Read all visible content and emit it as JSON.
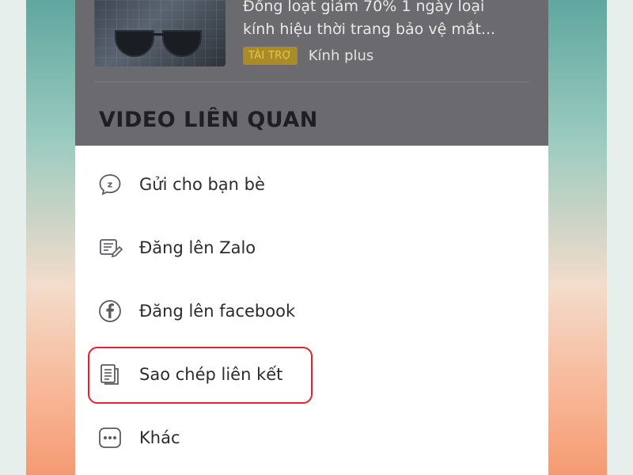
{
  "ad": {
    "headline_line1": "Đồng loạt giảm 70% 1 ngày loại",
    "headline_line2": "kính hiệu thời trang bảo vệ mắt...",
    "sponsor_badge": "TÀI TRỢ",
    "brand": "Kính plus"
  },
  "section": {
    "title": "VIDEO LIÊN QUAN"
  },
  "share_menu": {
    "items": [
      {
        "label": "Gửi cho bạn bè",
        "icon": "zalo-chat-icon"
      },
      {
        "label": "Đăng lên Zalo",
        "icon": "post-edit-icon"
      },
      {
        "label": "Đăng lên facebook",
        "icon": "facebook-icon"
      },
      {
        "label": "Sao chép liên kết",
        "icon": "copy-document-icon"
      },
      {
        "label": "Khác",
        "icon": "more-dots-icon"
      }
    ],
    "highlighted_index": 3,
    "highlight_color": "#e5222f"
  }
}
